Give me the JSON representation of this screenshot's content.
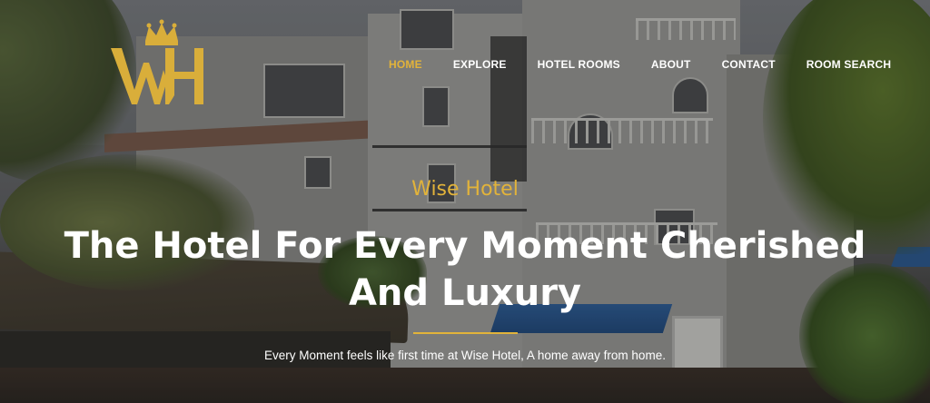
{
  "brand": {
    "logo_letters": "WH",
    "logo_color": "#D9AE3A"
  },
  "nav": {
    "items": [
      {
        "label": "HOME",
        "active": true
      },
      {
        "label": "EXPLORE",
        "active": false
      },
      {
        "label": "HOTEL ROOMS",
        "active": false
      },
      {
        "label": "ABOUT",
        "active": false
      },
      {
        "label": "CONTACT",
        "active": false
      },
      {
        "label": "ROOM SEARCH",
        "active": false
      }
    ],
    "active_color": "#E2B33A",
    "text_color": "#FFFFFF"
  },
  "hero": {
    "eyebrow": "Wise Hotel",
    "headline_line1": "The Hotel For Every Moment Cherished",
    "headline_line2": "And Luxury",
    "tagline": "Every Moment feels like first time at Wise Hotel, A home away from home.",
    "accent_color": "#E2B33A"
  }
}
